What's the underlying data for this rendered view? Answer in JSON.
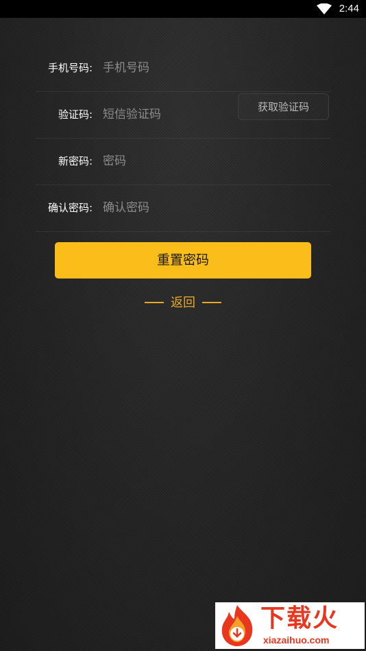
{
  "status_bar": {
    "time": "2:44",
    "wifi_icon": "wifi-icon"
  },
  "form": {
    "phone": {
      "label": "手机号码:",
      "placeholder": "手机号码"
    },
    "code": {
      "label": "验证码:",
      "placeholder": "短信验证码",
      "get_code_label": "获取验证码"
    },
    "new_password": {
      "label": "新密码:",
      "placeholder": "密码"
    },
    "confirm_password": {
      "label": "确认密码:",
      "placeholder": "确认密码"
    }
  },
  "actions": {
    "reset_label": "重置密码",
    "back_label": "返回"
  },
  "colors": {
    "accent": "#fbbd19",
    "back_link": "#e8a82a",
    "background": "#262626"
  },
  "watermark": {
    "brand": "下载火",
    "url": "xiazaihuo.com",
    "logo_icon": "flame-download-icon"
  }
}
